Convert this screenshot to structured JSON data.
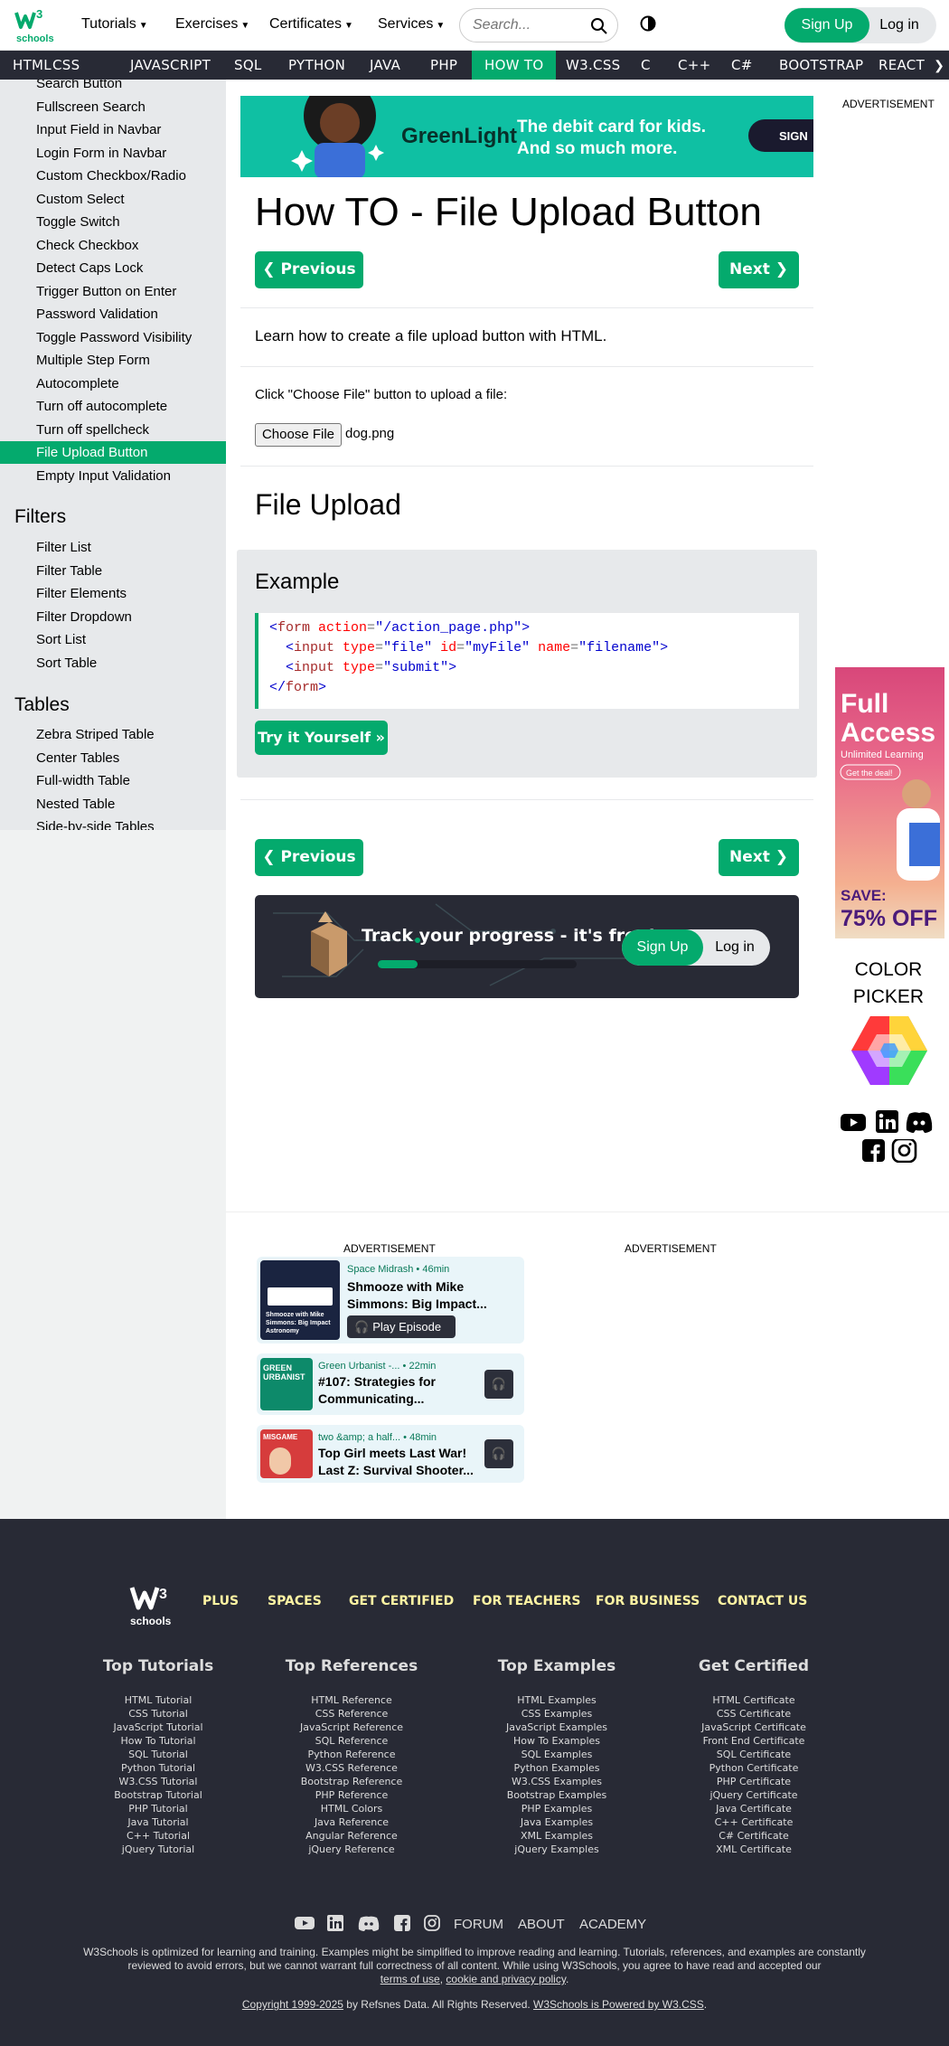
{
  "header": {
    "logo_text": "schools",
    "nav": [
      "Tutorials",
      "Exercises",
      "Certificates",
      "Services"
    ],
    "search_placeholder": "Search...",
    "signup": "Sign Up",
    "login": "Log in"
  },
  "subnav": {
    "items": [
      "HTML",
      "CSS",
      "JAVASCRIPT",
      "SQL",
      "PYTHON",
      "JAVA",
      "PHP",
      "HOW TO",
      "W3.CSS",
      "C",
      "C++",
      "C#",
      "BOOTSTRAP",
      "REACT"
    ],
    "active": "HOW TO"
  },
  "sidebar": {
    "links_top": [
      "Search Button",
      "Fullscreen Search",
      "Input Field in Navbar",
      "Login Form in Navbar",
      "Custom Checkbox/Radio",
      "Custom Select",
      "Toggle Switch",
      "Check Checkbox",
      "Detect Caps Lock",
      "Trigger Button on Enter",
      "Password Validation",
      "Toggle Password Visibility",
      "Multiple Step Form",
      "Autocomplete",
      "Turn off autocomplete",
      "Turn off spellcheck",
      "File Upload Button",
      "Empty Input Validation"
    ],
    "active": "File Upload Button",
    "filters_heading": "Filters",
    "filters": [
      "Filter List",
      "Filter Table",
      "Filter Elements",
      "Filter Dropdown",
      "Sort List",
      "Sort Table"
    ],
    "tables_heading": "Tables",
    "tables": [
      "Zebra Striped Table",
      "Center Tables",
      "Full-width Table",
      "Nested Table",
      "Side-by-side Tables"
    ]
  },
  "ad_banner": {
    "brand": "GreenLight",
    "line1": "The debit card for kids.",
    "line2": "And so much more.",
    "cta": "SIGN"
  },
  "main": {
    "title": "How TO - File Upload Button",
    "prev": "❮ Previous",
    "next": "Next ❯",
    "intro": "Learn how to create a file upload button with HTML.",
    "instruction": "Click \"Choose File\" button to upload a file:",
    "choose_file": "Choose File",
    "file_name": "dog.png",
    "section_heading": "File Upload",
    "example_heading": "Example",
    "code": {
      "l1": {
        "open": "<",
        "tag": "form",
        "attr1": " action",
        "eq": "=",
        "val1": "\"/action_page.php\"",
        "close": ">"
      },
      "l2": {
        "open": "<",
        "tag": "input",
        "attr1": " type",
        "val1": "\"file\"",
        "attr2": " id",
        "val2": "\"myFile\"",
        "attr3": " name",
        "val3": "\"filename\"",
        "close": ">"
      },
      "l3": {
        "open": "<",
        "tag": "input",
        "attr1": " type",
        "val1": "\"submit\"",
        "close": ">"
      },
      "l4": {
        "open": "</",
        "tag": "form",
        "close": ">"
      }
    },
    "try_it": "Try it Yourself »",
    "track_title": "Track your progress - it's free!",
    "track_signup": "Sign Up",
    "track_login": "Log in",
    "track_progress": 0.2
  },
  "right": {
    "advertisement": "ADVERTISEMENT",
    "promo_line1": "Full",
    "promo_line2": "Access",
    "promo_sub": "Unlimited Learning",
    "promo_cta": "Get the deal!",
    "promo_save": "SAVE:",
    "promo_off": "75% OFF",
    "color_picker": "COLOR PICKER"
  },
  "lower_ads": {
    "label_left": "ADVERTISEMENT",
    "label_right": "ADVERTISEMENT",
    "pods": [
      {
        "show": "Space Midrash",
        "duration": "46min",
        "title": "Shmooze with Mike Simmons: Big Impact...",
        "button": "Play Episode",
        "thumb_text": "Shmooze with Mike Simmons: Big Impact Astronomy"
      },
      {
        "show": "Green Urbanist -...",
        "duration": "22min",
        "title": "#107: Strategies for Communicating...",
        "thumb_text": "GREEN URBANIST"
      },
      {
        "show": "two &amp; a half...",
        "duration": "48min",
        "title": "Top Girl meets Last War! Last Z: Survival Shooter...",
        "thumb_text": "MISGAME"
      }
    ]
  },
  "footer": {
    "links": [
      "PLUS",
      "SPACES",
      "GET CERTIFIED",
      "FOR TEACHERS",
      "FOR BUSINESS",
      "CONTACT US"
    ],
    "columns": [
      {
        "heading": "Top Tutorials",
        "items": [
          "HTML Tutorial",
          "CSS Tutorial",
          "JavaScript Tutorial",
          "How To Tutorial",
          "SQL Tutorial",
          "Python Tutorial",
          "W3.CSS Tutorial",
          "Bootstrap Tutorial",
          "PHP Tutorial",
          "Java Tutorial",
          "C++ Tutorial",
          "jQuery Tutorial"
        ]
      },
      {
        "heading": "Top References",
        "items": [
          "HTML Reference",
          "CSS Reference",
          "JavaScript Reference",
          "SQL Reference",
          "Python Reference",
          "W3.CSS Reference",
          "Bootstrap Reference",
          "PHP Reference",
          "HTML Colors",
          "Java Reference",
          "Angular Reference",
          "jQuery Reference"
        ]
      },
      {
        "heading": "Top Examples",
        "items": [
          "HTML Examples",
          "CSS Examples",
          "JavaScript Examples",
          "How To Examples",
          "SQL Examples",
          "Python Examples",
          "W3.CSS Examples",
          "Bootstrap Examples",
          "PHP Examples",
          "Java Examples",
          "XML Examples",
          "jQuery Examples"
        ]
      },
      {
        "heading": "Get Certified",
        "items": [
          "HTML Certificate",
          "CSS Certificate",
          "JavaScript Certificate",
          "Front End Certificate",
          "SQL Certificate",
          "Python Certificate",
          "PHP Certificate",
          "jQuery Certificate",
          "Java Certificate",
          "C++ Certificate",
          "C# Certificate",
          "XML Certificate"
        ]
      }
    ],
    "bottom_links": [
      "FORUM",
      "ABOUT",
      "ACADEMY"
    ],
    "desc1": "W3Schools is optimized for learning and training. Examples might be simplified to improve reading and learning. Tutorials, references, and examples are constantly reviewed to avoid errors, but we cannot warrant full correctness of all content. While using W3Schools, you agree to have read and accepted our",
    "terms": "terms of use",
    "sep": ",",
    "privacy": "cookie and privacy policy",
    "dot": ".",
    "copyright": "Copyright 1999-2025",
    "copy_mid": " by Refsnes Data. All Rights Reserved. ",
    "powered": "W3Schools is Powered by W3.CSS",
    "copy_end": "."
  },
  "colors": {
    "accent": "#04aa6d",
    "dark": "#282a35",
    "footer_link": "#fff4a3"
  }
}
